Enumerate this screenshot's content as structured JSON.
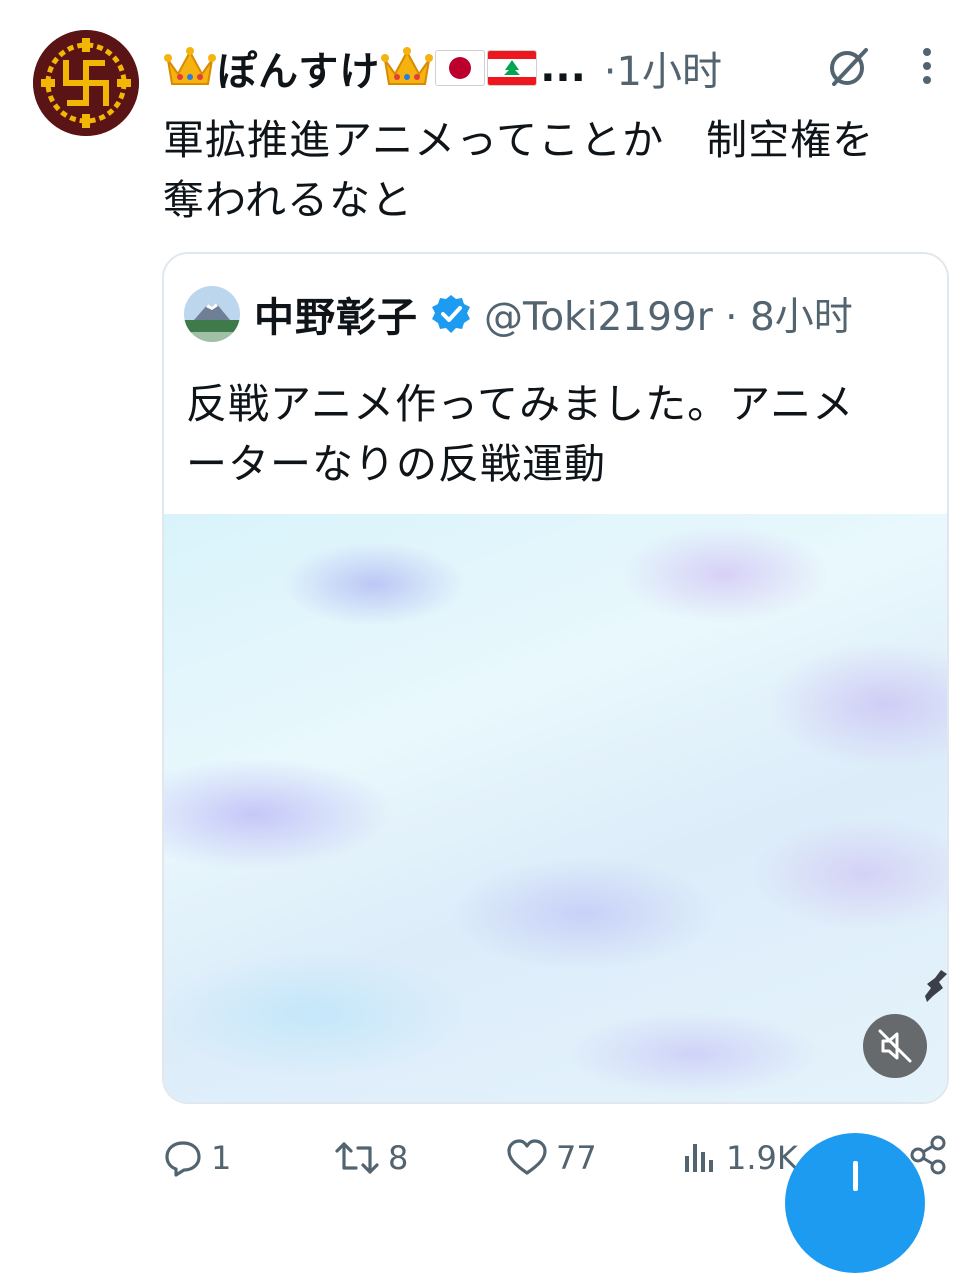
{
  "post": {
    "author_name": "ぽんすけ",
    "author_suffix": "...",
    "time": "·1小时",
    "text_line1": "軍拡推進アニメってことか　制空権を",
    "text_line2": "奪われるなと"
  },
  "quote": {
    "author_name": "中野彰子",
    "handle_time": "@Toki2199r · 8小时",
    "text_line1": "反戦アニメ作ってみました。アニメ",
    "text_line2": "ーターなりの反戦運動"
  },
  "actions": {
    "reply_count": "1",
    "repost_count": "8",
    "like_count": "77",
    "views_count": "1.9K"
  },
  "colors": {
    "accent": "#1d9bf0",
    "secondary_text": "#536471",
    "avatar_bg": "#5b1416",
    "avatar_fg": "#f2b705"
  },
  "icons": [
    "crown-emoji",
    "japan-flag-emoji",
    "lebanon-flag-emoji",
    "grok-icon",
    "more-vertical-icon",
    "verified-badge-icon",
    "mute-icon",
    "reply-icon",
    "repost-icon",
    "like-icon",
    "views-icon",
    "share-icon",
    "compose-plus-icon"
  ]
}
